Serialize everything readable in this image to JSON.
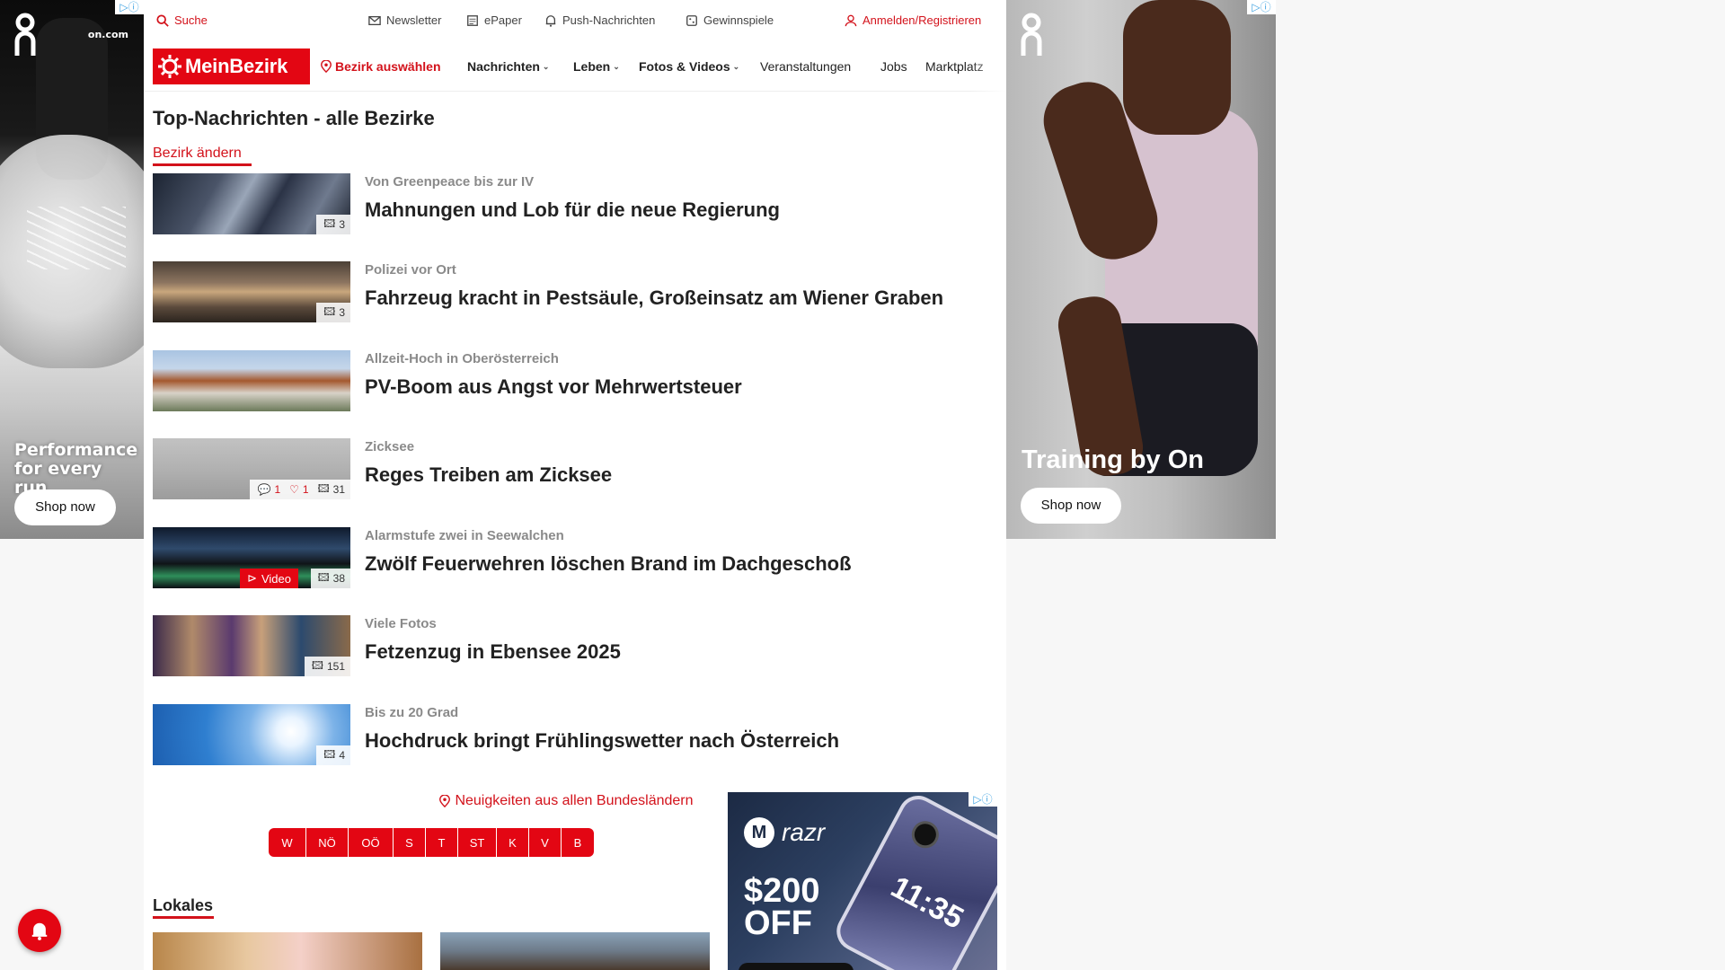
{
  "colors": {
    "brand_red": "#e30613",
    "link_red": "#d3121b",
    "kicker_gray": "#8a8a8a"
  },
  "ads": {
    "left": {
      "brand": "on",
      "domain": "on.com",
      "tagline": "Performance for every run",
      "button": "Shop now"
    },
    "right": {
      "brand": "on",
      "tagline": "Training by On",
      "button": "Shop now"
    },
    "razr": {
      "brand": "razr",
      "offer_line1": "$200",
      "offer_line2": "OFF",
      "clock": "11:35"
    }
  },
  "utility": {
    "search": "Suche",
    "newsletter": "Newsletter",
    "epaper": "ePaper",
    "push": "Push-Nachrichten",
    "gewinnspiele": "Gewinnspiele",
    "login": "Anmelden/Registrieren"
  },
  "nav": {
    "logo": "MeinBezirk",
    "select_district": "Bezirk auswählen",
    "items": [
      "Nachrichten",
      "Leben",
      "Fotos & Videos",
      "Veranstaltungen",
      "Jobs",
      "Marktplatz"
    ]
  },
  "page": {
    "title": "Top-Nachrichten - alle Bezirke",
    "change_district": "Bezirk ändern"
  },
  "articles": [
    {
      "kicker": "Von Greenpeace bis zur IV",
      "headline": "Mahnungen und Lob für die neue Regierung",
      "photos": "3"
    },
    {
      "kicker": "Polizei vor Ort",
      "headline": "Fahrzeug kracht in Pestsäule, Großeinsatz am Wiener Graben",
      "photos": "3"
    },
    {
      "kicker": "Allzeit-Hoch in Oberösterreich",
      "headline": "PV-Boom aus Angst vor Mehrwertsteuer",
      "photos": ""
    },
    {
      "kicker": "Zicksee",
      "headline": "Reges Treiben am Zicksee",
      "comments": "1",
      "likes": "1",
      "photos": "31"
    },
    {
      "kicker": "Alarmstufe zwei in Seewalchen",
      "headline": "Zwölf Feuerwehren löschen Brand im Dachgeschoß",
      "video": "Video",
      "photos": "38"
    },
    {
      "kicker": "Viele Fotos",
      "headline": "Fetzenzug in Ebensee 2025",
      "photos": "151"
    },
    {
      "kicker": "Bis zu 20 Grad",
      "headline": "Hochdruck bringt Frühlingswetter nach Österreich",
      "photos": "4"
    }
  ],
  "states": {
    "title": "Neuigkeiten aus allen Bundesländern",
    "items": [
      "W",
      "NÖ",
      "OÖ",
      "S",
      "T",
      "ST",
      "K",
      "V",
      "B"
    ]
  },
  "lokales": {
    "title": "Lokales"
  }
}
